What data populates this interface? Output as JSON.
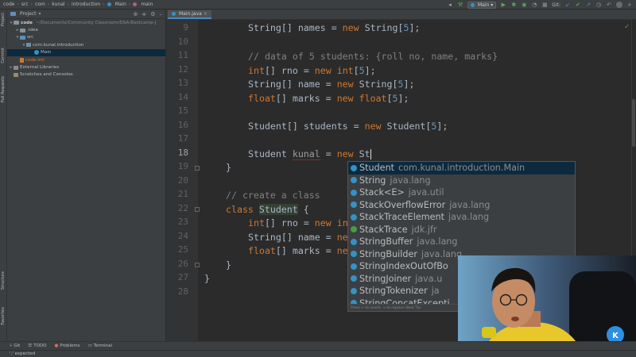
{
  "breadcrumbs": [
    "code",
    "src",
    "com",
    "kunal",
    "introduction",
    "Main",
    "main"
  ],
  "toolbar": {
    "run_config": "Main",
    "git_label": "Git:"
  },
  "left_strip": {
    "project_tab": "Project",
    "commit_tab": "Commit",
    "pull_requests_tab": "Pull Requests",
    "structure_tab": "Structure",
    "favorites_tab": "Favorites"
  },
  "project_panel": {
    "title": "Project",
    "tree": [
      {
        "label": "code",
        "extra": "~/Documents/Community Classroom/DSA-Bootcamp-J"
      },
      {
        "label": ".idea"
      },
      {
        "label": "src"
      },
      {
        "label": "com.kunal.introduction"
      },
      {
        "label": "Main"
      },
      {
        "label": "code.iml"
      },
      {
        "label": "External Libraries"
      },
      {
        "label": "Scratches and Consoles"
      }
    ]
  },
  "editor": {
    "tab_label": "Main.java",
    "line_numbers": [
      "9",
      "10",
      "11",
      "12",
      "13",
      "14",
      "15",
      "16",
      "17",
      "18",
      "19",
      "20",
      "21",
      "22",
      "23",
      "24",
      "25",
      "26",
      "27",
      "28"
    ],
    "lines": {
      "l9": {
        "type": "String",
        "rest1": "[] names = ",
        "kw": "new",
        "rest2": " String[",
        "num": "5",
        "rest3": "];"
      },
      "l11": "// data of 5 students: {roll no, name, marks}",
      "l12": {
        "kw1": "int",
        "mid": "[] rno = ",
        "kw2": "new",
        "sp": " ",
        "kw3": "int",
        "br1": "[",
        "num": "5",
        "br2": "];"
      },
      "l13": {
        "type": "String",
        "rest1": "[] name = ",
        "kw": "new",
        "rest2": " String[",
        "num": "5",
        "rest3": "];"
      },
      "l14": {
        "kw1": "float",
        "mid": "[] marks = ",
        "kw2": "new",
        "sp": " ",
        "kw3": "float",
        "br1": "[",
        "num": "5",
        "br2": "];"
      },
      "l16": {
        "type": "Student",
        "rest1": "[] students = ",
        "kw": "new",
        "rest2": " Student[",
        "num": "5",
        "rest3": "];"
      },
      "l18": {
        "type": "Student ",
        "var": "kunal",
        "eq": " = ",
        "kw": "new",
        "typed": " St"
      },
      "l19": "}",
      "l21": "// create a class",
      "l22": {
        "kw": "class",
        "name": "Student",
        "brace": " {"
      },
      "l23": {
        "kw": "int",
        "rest": "[] rno = ",
        "kw2": "new",
        "tail": " in"
      },
      "l24": {
        "type": "String",
        "rest": "[] name = ",
        "kw2": "ne"
      },
      "l25": {
        "kw": "float",
        "rest": "[] marks = ",
        "kw2": "ne"
      },
      "l26": "}",
      "l27": "}"
    }
  },
  "completion": {
    "items": [
      {
        "name": "Student",
        "pkg": "com.kunal.introduction.Main"
      },
      {
        "name": "String",
        "pkg": "java.lang"
      },
      {
        "name": "Stack<E>",
        "pkg": "java.util"
      },
      {
        "name": "StackOverflowError",
        "pkg": "java.lang"
      },
      {
        "name": "StackTraceElement",
        "pkg": "java.lang"
      },
      {
        "name": "StackTrace",
        "pkg": "jdk.jfr"
      },
      {
        "name": "StringBuffer",
        "pkg": "java.lang"
      },
      {
        "name": "StringBuilder",
        "pkg": "java.lang"
      },
      {
        "name": "StringIndexOutOfBo",
        "pkg": ""
      },
      {
        "name": "StringJoiner",
        "pkg": "java.u"
      },
      {
        "name": "StringTokenizer",
        "pkg": "ja"
      },
      {
        "name": "StringConcatExcepti",
        "pkg": ""
      }
    ],
    "footer": "Press ↵ to insert, → to replace  Next Tip"
  },
  "bottom_bar": {
    "git": "Git",
    "todo": "TODO",
    "problems": "Problems",
    "terminal": "Terminal"
  },
  "status": "';' expected",
  "colors": {
    "keyword": "#cc7832",
    "comment": "#808080",
    "number": "#6897bb",
    "text": "#a9b7c6",
    "selection": "#0d293e",
    "accent": "#4a88c7"
  }
}
